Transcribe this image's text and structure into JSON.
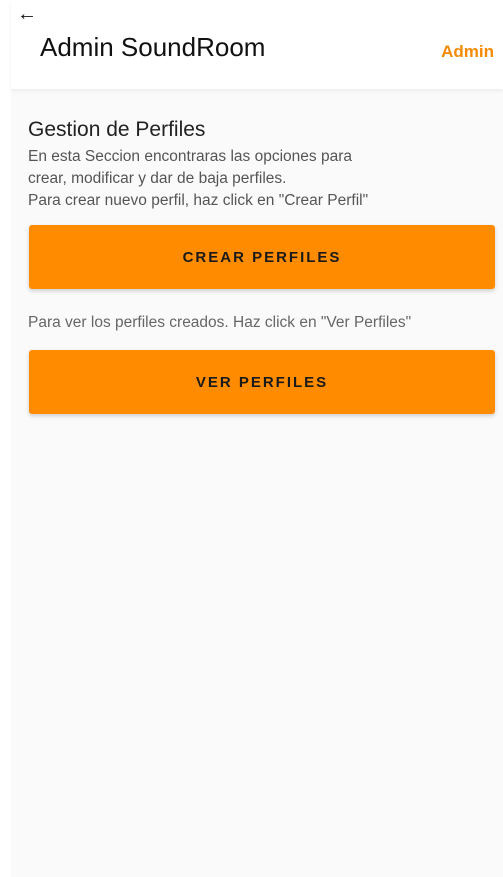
{
  "header": {
    "back_icon": "arrow-left-icon",
    "title": "Admin SoundRoom",
    "user_label": "Admin",
    "accent_color": "#f58a07"
  },
  "main": {
    "section_title": "Gestion de Perfiles",
    "description": [
      "En esta Seccion encontraras las opciones para",
      "crear, modificar y dar de baja perfiles.",
      "Para crear nuevo perfil, haz click en \"Crear Perfil\""
    ],
    "create_button": "CREAR PERFILES",
    "view_note": "Para ver los perfiles creados. Haz click en \"Ver Perfiles\"",
    "view_button": "VER PERFILES",
    "button_color": "#ff8c00"
  }
}
